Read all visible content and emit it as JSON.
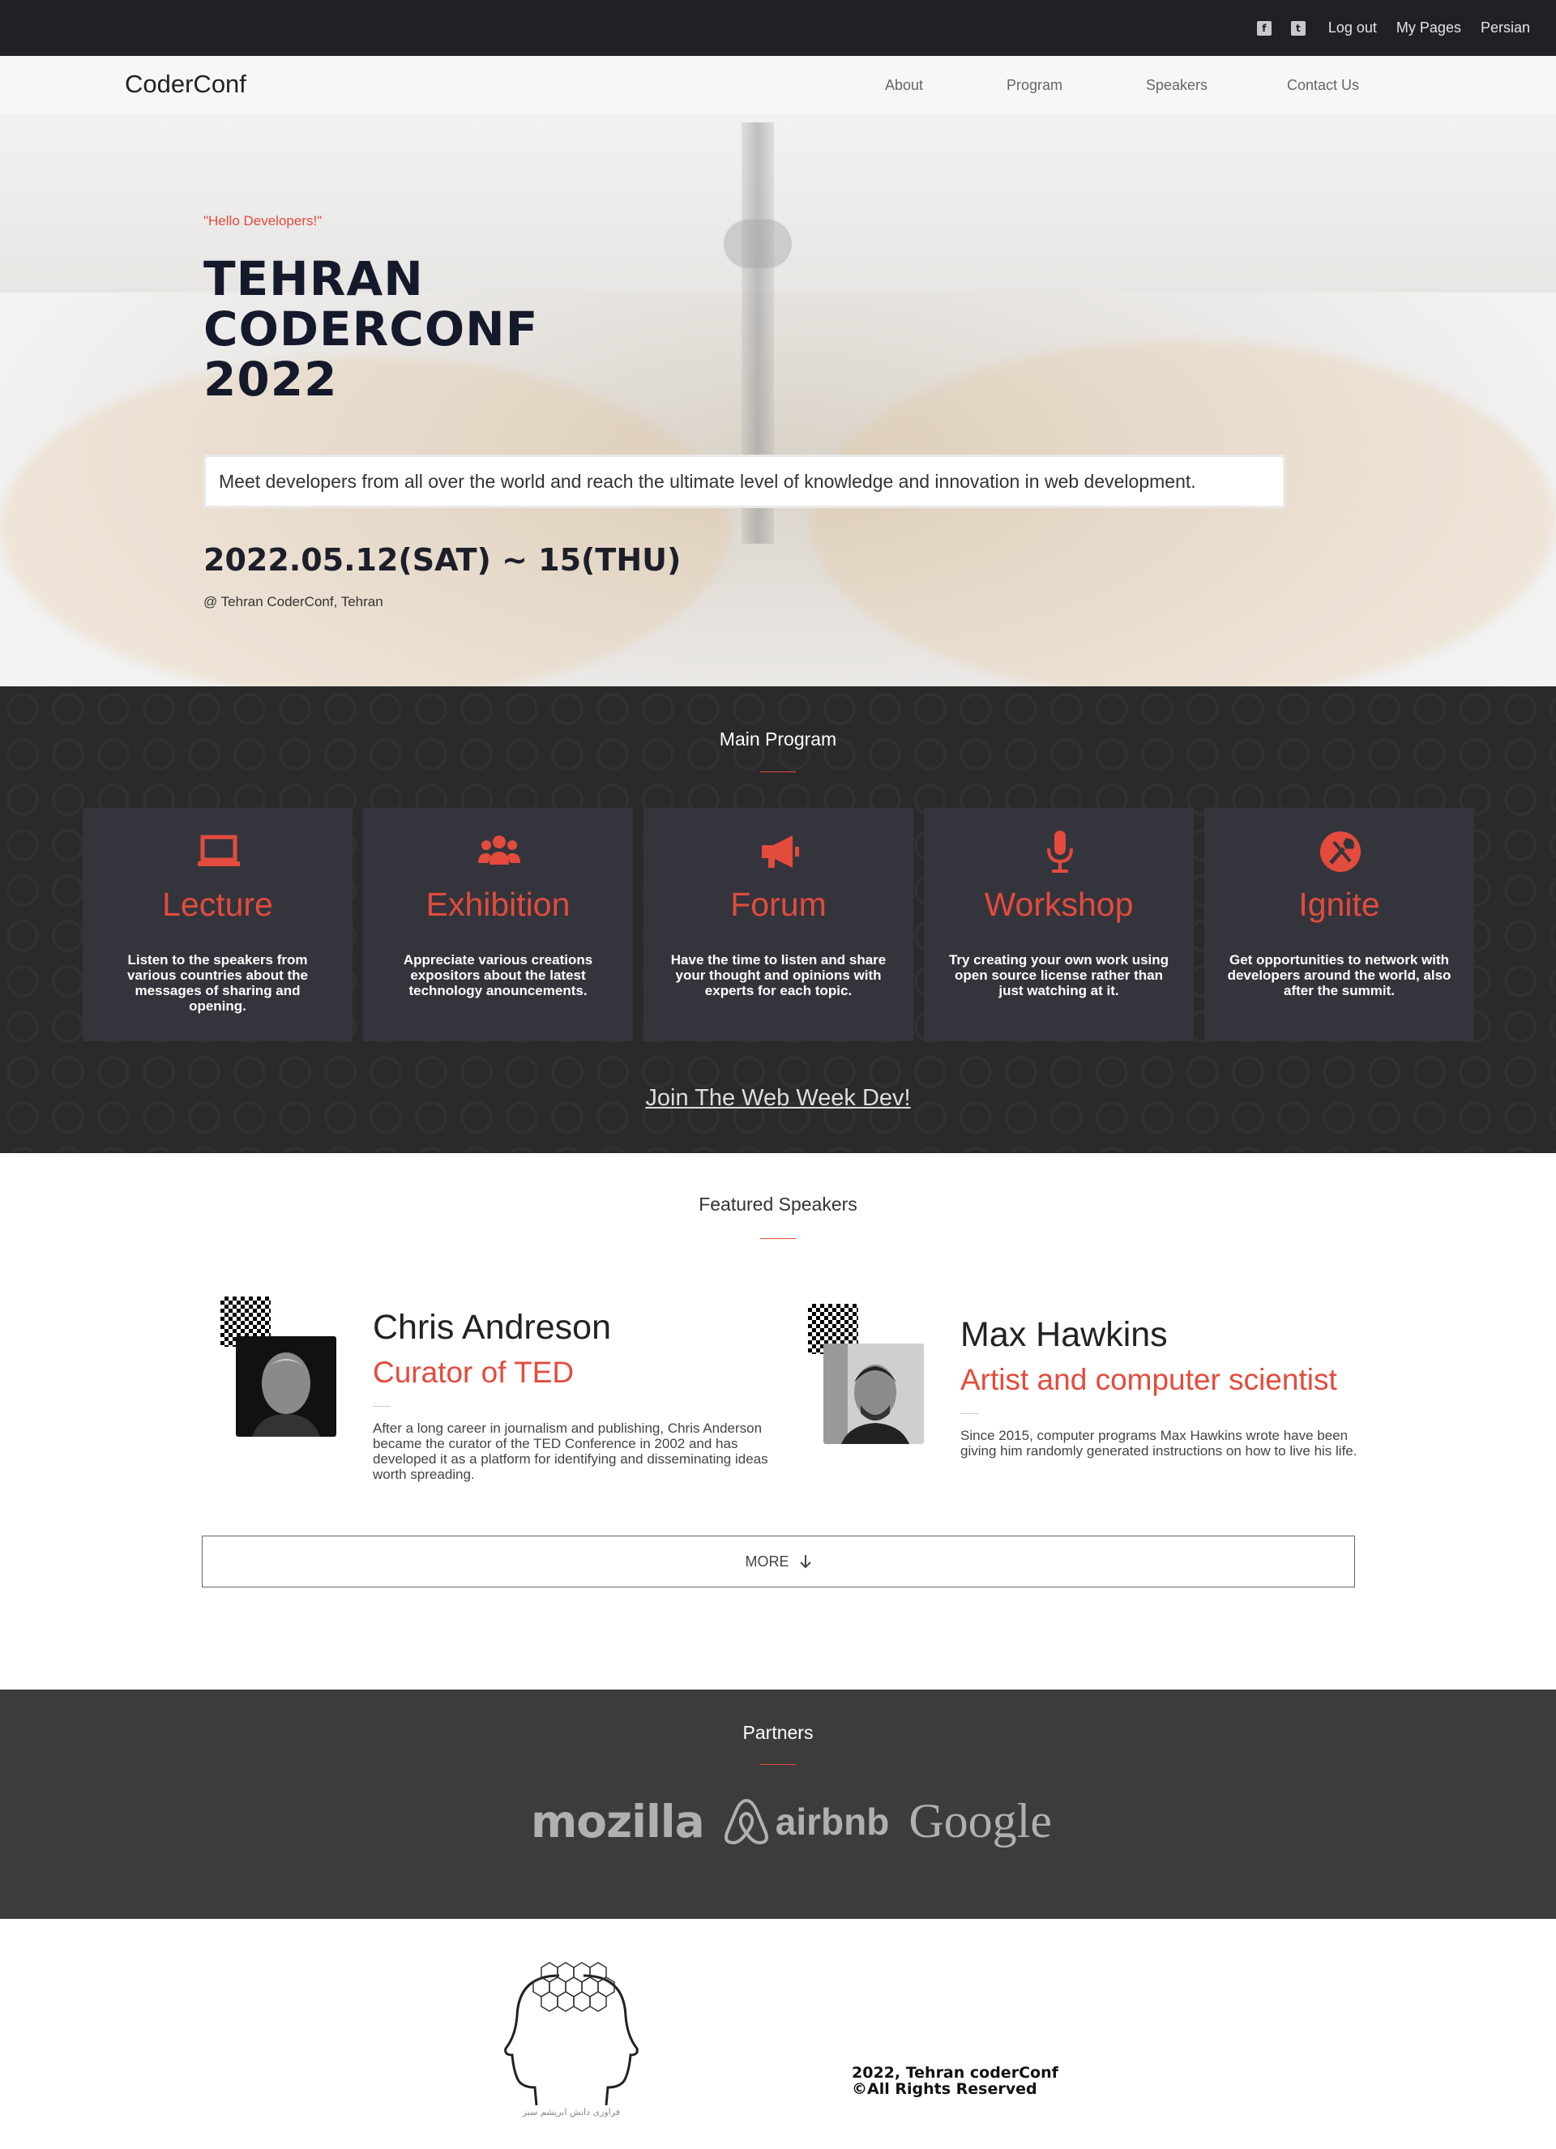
{
  "topbar": {
    "social": [
      {
        "icon": "facebook-square-icon",
        "glyph": "f"
      },
      {
        "icon": "twitter-square-icon",
        "glyph": "t"
      }
    ],
    "links": [
      "Log out",
      "My Pages",
      "Persian"
    ]
  },
  "nav": {
    "brand": "CoderConf",
    "items": [
      "About",
      "Program",
      "Speakers",
      "Contact Us"
    ]
  },
  "hero": {
    "tagline": "\"Hello Developers!\"",
    "title_lines": [
      "TEHRAN",
      "CODERCONF",
      "2022"
    ],
    "description": "Meet developers from all over the world and reach the ultimate level of knowledge and innovation in web development.",
    "dates": "2022.05.12(SAT) ~ 15(THU)",
    "venue": "@ Tehran CoderConf, Tehran"
  },
  "program": {
    "title": "Main Program",
    "cards": [
      {
        "icon": "laptop-icon",
        "title": "Lecture",
        "desc": "Listen to the speakers from various countries about the messages of sharing and opening."
      },
      {
        "icon": "users-icon",
        "title": "Exhibition",
        "desc": "Appreciate various creations expositors about the latest technology anouncements."
      },
      {
        "icon": "megaphone-icon",
        "title": "Forum",
        "desc": "Have the time to listen and share your thought and opinions with experts for each topic."
      },
      {
        "icon": "microphone-icon",
        "title": "Workshop",
        "desc": "Try creating your own work using open source license rather than just watching at it."
      },
      {
        "icon": "wrench-icon",
        "title": "Ignite",
        "desc": "Get opportunities to network with developers around the world, also after the summit."
      }
    ],
    "join": "Join The Web Week Dev!"
  },
  "speakers": {
    "title": "Featured Speakers",
    "list": [
      {
        "name": "Chris Andreson",
        "role": "Curator of TED",
        "bio": "After a long career in journalism and publishing, Chris Anderson became the curator of the TED Conference in 2002 and has developed it as a platform for identifying and disseminating ideas worth spreading."
      },
      {
        "name": "Max Hawkins",
        "role": "Artist and computer scientist",
        "bio": "Since 2015, computer programs Max Hawkins wrote have been giving him randomly generated instructions on how to live his life."
      }
    ],
    "more": "MORE"
  },
  "partners": {
    "title": "Partners",
    "logos": [
      "mozilla",
      "airbnb",
      "Google"
    ]
  },
  "footer": {
    "copyright_lines": [
      "2022, Tehran coderConf",
      "©All Rights Reserved"
    ],
    "logo_caption": "فراوری دانش ابریشم سبز"
  },
  "colors": {
    "accent": "#e34b3c",
    "topbar": "#1f2127",
    "program_bg": "#2a2a2a",
    "card_bg": "#34353c",
    "partners_bg": "#3c3c3c"
  }
}
